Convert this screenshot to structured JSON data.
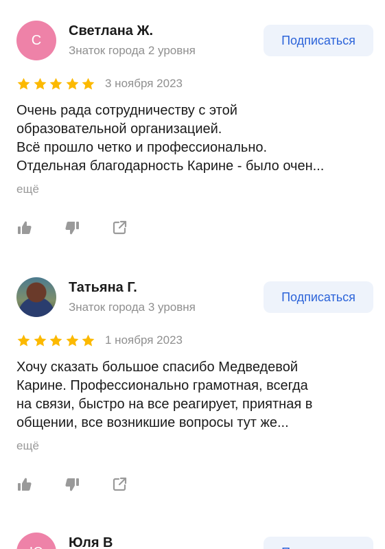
{
  "reviews": [
    {
      "avatar_letter": "С",
      "avatar_color": "#ee82a8",
      "name": "Светлана Ж.",
      "level": "Знаток города 2 уровня",
      "subscribe_label": "Подписаться",
      "rating": 5,
      "date": "3 ноября 2023",
      "text": "Очень рада сотрудничеству с этой\nобразовательной организацией.\nВсё прошло четко и профессионально.\nОтдельная благодарность Карине - было очен...",
      "more_label": "ещё"
    },
    {
      "avatar_letter": "",
      "name": "Татьяна Г.",
      "level": "Знаток города 3 уровня",
      "subscribe_label": "Подписаться",
      "rating": 5,
      "date": "1 ноября 2023",
      "text": "Хочу сказать большое спасибо Медведевой\nКарине. Профессионально грамотная, всегда\nна связи, быстро на все реагирует, приятная в\nобщении, все возникшие вопросы тут же...",
      "more_label": "ещё"
    },
    {
      "avatar_letter": "Ю",
      "avatar_color": "#ee82a8",
      "name": "Юля В",
      "subscribe_label": "Подписаться"
    }
  ],
  "colors": {
    "star": "#fcb900",
    "accent": "#2b63d9",
    "button_bg": "#eef3fb",
    "muted": "#8f8f8f"
  },
  "icons": [
    "star-icon",
    "thumbs-up-icon",
    "thumbs-down-icon",
    "share-icon"
  ]
}
